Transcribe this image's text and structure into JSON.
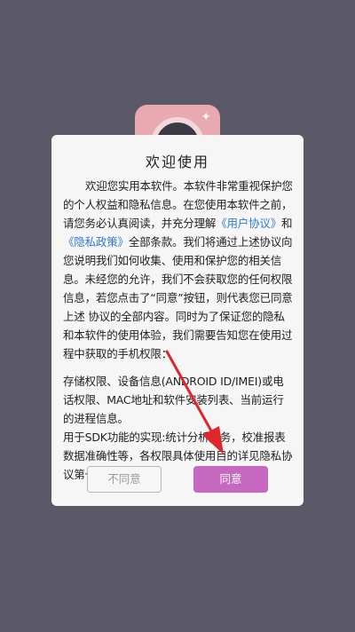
{
  "dialog": {
    "title": "欢迎使用",
    "para1_a": "欢迎您实用本软件。本软件非常重视保护您的个人权益和隐私信息。在您使用本软件之前，请您务必认真阅读，并充分理解",
    "link_user_agreement": "《用户协议》",
    "para1_b": "和",
    "link_privacy_policy": "《隐私政策》",
    "para1_c": "全部条款。我们将通过上述协议向您说明我们如何收集、使用和保护您的相关信息。未经您的允许，我们不会获取您的任何权限信息，若您点击了“同意”按钮，则代表您已同意上述 协议的全部内容。同时为了保证您的隐私和本软件的使用体验，我们需要告知您在使用过程中获取的手机权限：",
    "para2": "存储权限、设备信息(ANDROID ID/IMEI)或电话权限、MAC地址和软件安装列表、当前运行的进程信息。",
    "para3": "用于SDK功能的实现:统计分析服务，校准报表数据准确性等，各权限具体使用目的详见隐私协议第七条；",
    "disagree_label": "不同意",
    "agree_label": "同意"
  },
  "colors": {
    "background": "#5b5968",
    "dialog": "#f6f6f6",
    "link": "#2f7bd6",
    "agree_button": "#c668c0",
    "annotation_arrow": "#e0262d"
  },
  "icons": {
    "app_logo": "camera-lens-icon",
    "annotation": "red-arrow-icon"
  }
}
